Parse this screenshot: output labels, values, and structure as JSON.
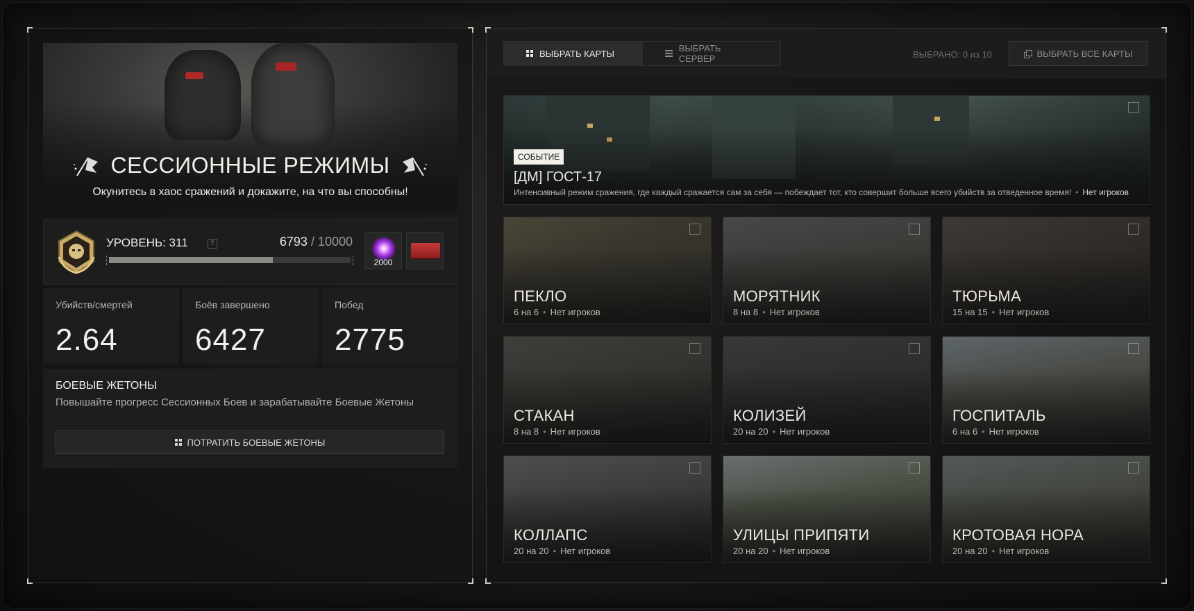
{
  "left": {
    "hero": {
      "title": "СЕССИОННЫЕ РЕЖИМЫ",
      "subtitle": "Окунитесь в хаос сражений и докажите, на что вы способны!"
    },
    "level": {
      "label": "УРОВЕНЬ: 311",
      "help": "?",
      "xp_current": "6793",
      "xp_max": "/ 10000",
      "progress_fraction": 0.6793,
      "reward_orb_value": "2000"
    },
    "stats": [
      {
        "label": "Убийств/смертей",
        "value": "2.64"
      },
      {
        "label": "Боёв завершено",
        "value": "6427"
      },
      {
        "label": "Побед",
        "value": "2775"
      }
    ],
    "tokens": {
      "title": "БОЕВЫЕ ЖЕТОНЫ",
      "description": "Повышайте прогресс Сессионных Боев и зарабатывайте Боевые Жетоны",
      "button": "ПОТРАТИТЬ БОЕВЫЕ ЖЕТОНЫ"
    }
  },
  "right": {
    "tabs": [
      {
        "label": "ВЫБРАТЬ КАРТЫ",
        "icon": "grid-icon",
        "active": true
      },
      {
        "label": "ВЫБРАТЬ СЕРВЕР",
        "icon": "list-icon",
        "active": false
      }
    ],
    "selected_count": "ВЫБРАНО: 0 из 10",
    "select_all": "ВЫБРАТЬ ВСЕ КАРТЫ",
    "featured": {
      "tag": "СОБЫТИЕ",
      "name": "[ДМ] ГОСТ-17",
      "description": "Интенсивный режим сражения, где каждый сражается сам за себя — побеждает тот, кто совершит больше всего убийств за отведенное время!",
      "dot": "•",
      "players": "Нет игроков"
    },
    "maps": [
      {
        "name": "ПЕКЛО",
        "size": "6 на 6",
        "players": "Нет игроков"
      },
      {
        "name": "МОРЯТНИК",
        "size": "8 на 8",
        "players": "Нет игроков"
      },
      {
        "name": "ТЮРЬМА",
        "size": "15 на 15",
        "players": "Нет игроков"
      },
      {
        "name": "СТАКАН",
        "size": "8 на 8",
        "players": "Нет игроков"
      },
      {
        "name": "КОЛИЗЕЙ",
        "size": "20 на 20",
        "players": "Нет игроков"
      },
      {
        "name": "ГОСПИТАЛЬ",
        "size": "6 на 6",
        "players": "Нет игроков"
      },
      {
        "name": "КОЛЛАПС",
        "size": "20 на 20",
        "players": "Нет игроков"
      },
      {
        "name": "УЛИЦЫ ПРИПЯТИ",
        "size": "20 на 20",
        "players": "Нет игроков"
      },
      {
        "name": "КРОТОВАЯ НОРА",
        "size": "20 на 20",
        "players": "Нет игроков"
      }
    ],
    "dot": "•"
  }
}
